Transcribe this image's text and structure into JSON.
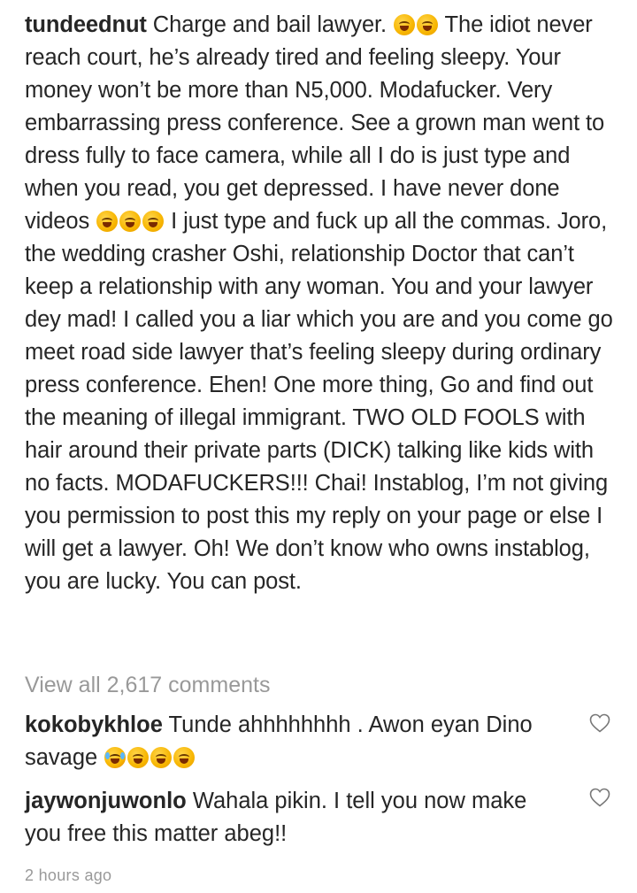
{
  "post": {
    "username": "tundeednut",
    "caption_part1": " Charge and bail lawyer. ",
    "caption_part2": "  The idiot never reach court, he’s already tired and feeling sleepy. Your money won’t be more than N5,000. Modafucker. Very embarrassing press conference. See a grown man went to dress fully to face camera, while all I do is just type and when you read, you get depressed. I have never done videos ",
    "caption_part3": "  I just type and fuck up all the commas. Joro, the wedding crasher Oshi, relationship Doctor that can’t keep a relationship with any woman. You and your lawyer dey mad! I called you a liar which you are and you come go meet road side lawyer that’s feeling sleepy during ordinary press conference. Ehen! One more thing, Go and find out the meaning of illegal immigrant. TWO OLD FOOLS with hair around their private parts (DICK) talking like kids with no facts. MODAFUCKERS!!! Chai! Instablog, I’m not giving you permission to post this my reply on your page or else I will get a lawyer. Oh! We don’t know who owns instablog, you are lucky. You can post."
  },
  "view_all": "View all 2,617 comments",
  "comments": [
    {
      "username": "kokobykhloe",
      "text": " Tunde ahhhhhhhh . Awon eyan Dino savage "
    },
    {
      "username": "jaywonjuwonlo",
      "text": " Wahala pikin.  I tell you now make you free this matter abeg!!"
    }
  ],
  "timestamp": "2 hours ago",
  "icons": {
    "emoji_laughing": "rolling-on-floor-laughing-emoji",
    "emoji_crying": "loudly-crying-emoji",
    "like": "heart-outline-icon"
  }
}
